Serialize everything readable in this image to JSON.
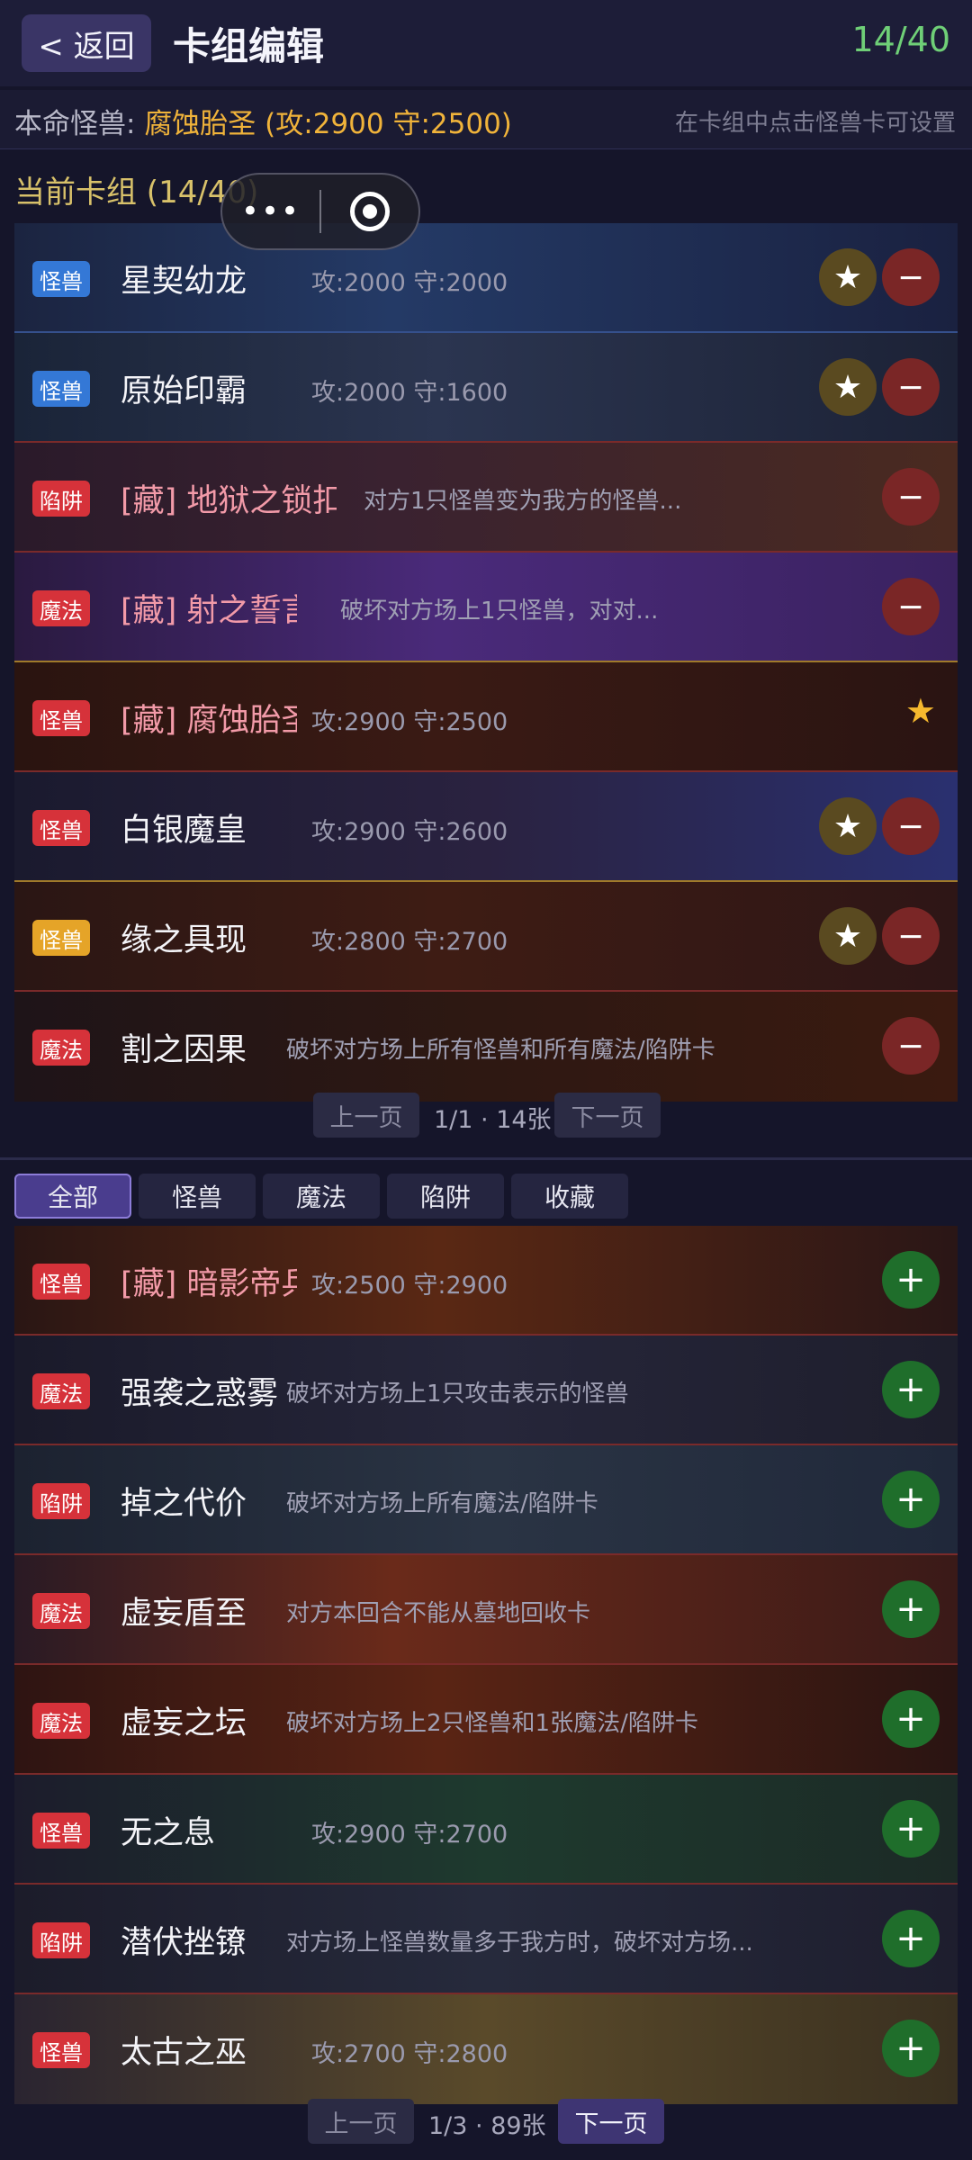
{
  "header": {
    "back_label": "< 返回",
    "title": "卡组编辑",
    "count": "14/40"
  },
  "main_monster": {
    "label": "本命怪兽: ",
    "value": "腐蚀胎圣 (攻:2900 守:2500)",
    "hint": "在卡组中点击怪兽卡可设置"
  },
  "deck": {
    "title": "当前卡组 (14/40)",
    "cards": [
      {
        "type": "怪兽",
        "name": "星契幼龙",
        "stats": "攻:2000 守:2000"
      },
      {
        "type": "怪兽",
        "name": "原始印霸",
        "stats": "攻:2000 守:1600"
      },
      {
        "type": "陷阱",
        "name": "[藏] 地狱之锁扣",
        "desc": "对方1只怪兽变为我方的怪兽..."
      },
      {
        "type": "魔法",
        "name": "[藏] 射之誓言",
        "desc": "破坏对方场上1只怪兽，对对..."
      },
      {
        "type": "怪兽",
        "name": "[藏] 腐蚀胎圣",
        "stats": "攻:2900 守:2500"
      },
      {
        "type": "怪兽",
        "name": "白银魔皇",
        "stats": "攻:2900 守:2600"
      },
      {
        "type": "怪兽",
        "name": "缘之具现",
        "stats": "攻:2800 守:2700"
      },
      {
        "type": "魔法",
        "name": "割之因果",
        "desc": "破坏对方场上所有怪兽和所有魔法/陷阱卡"
      }
    ],
    "pager": {
      "prev": "上一页",
      "info": "1/1 · 14张",
      "next": "下一页"
    }
  },
  "tabs": [
    "全部",
    "怪兽",
    "魔法",
    "陷阱",
    "收藏"
  ],
  "pool": {
    "cards": [
      {
        "type": "怪兽",
        "name": "[藏] 暗影帝兵",
        "stats": "攻:2500 守:2900"
      },
      {
        "type": "魔法",
        "name": "强袭之惑雾",
        "desc": "破坏对方场上1只攻击表示的怪兽"
      },
      {
        "type": "陷阱",
        "name": "掉之代价",
        "desc": "破坏对方场上所有魔法/陷阱卡"
      },
      {
        "type": "魔法",
        "name": "虚妄盾至",
        "desc": "对方本回合不能从墓地回收卡"
      },
      {
        "type": "魔法",
        "name": "虚妄之坛",
        "desc": "破坏对方场上2只怪兽和1张魔法/陷阱卡"
      },
      {
        "type": "怪兽",
        "name": "无之息",
        "stats": "攻:2900 守:2700"
      },
      {
        "type": "陷阱",
        "name": "潜伏挫镣",
        "desc": "对方场上怪兽数量多于我方时，破坏对方场..."
      },
      {
        "type": "怪兽",
        "name": "太古之巫",
        "stats": "攻:2700 守:2800"
      }
    ],
    "pager": {
      "prev": "上一页",
      "info": "1/3 · 89张",
      "next": "下一页"
    }
  },
  "icons": {
    "star": "★",
    "minus": "−",
    "plus": "+",
    "more": "•••"
  }
}
